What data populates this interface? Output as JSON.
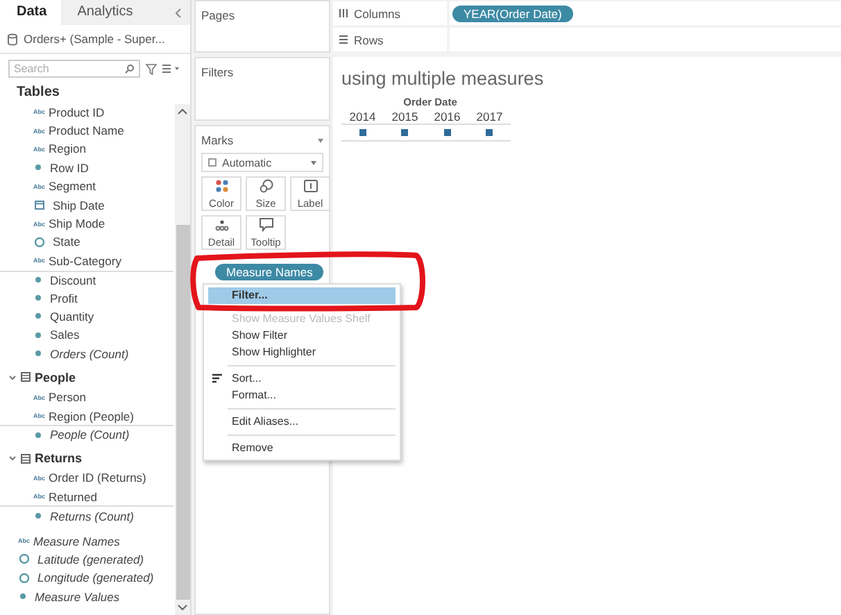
{
  "side_tabs": [
    {
      "label": "Data",
      "selected": true
    },
    {
      "label": "Analytics",
      "selected": false
    }
  ],
  "data_source": "Orders+ (Sample - Super...",
  "search": {
    "placeholder": "Search"
  },
  "tables": [
    {
      "name": "Tables",
      "collapsible": false,
      "expanded": true,
      "children": [
        {
          "name": "Product ID",
          "kind": "text",
          "type_label": "Abc",
          "italic": false
        },
        {
          "name": "Product Name",
          "kind": "text",
          "type_label": "Abc",
          "italic": false
        },
        {
          "name": "Region",
          "kind": "text",
          "type_label": "Abc",
          "italic": false
        },
        {
          "name": "Row ID",
          "kind": "number",
          "italic": false
        },
        {
          "name": "Segment",
          "kind": "text",
          "type_label": "Abc",
          "italic": false
        },
        {
          "name": "Ship Date",
          "kind": "date",
          "italic": false
        },
        {
          "name": "Ship Mode",
          "kind": "text",
          "type_label": "Abc",
          "italic": false
        },
        {
          "name": "State",
          "kind": "geo",
          "italic": false
        },
        {
          "name": "Sub-Category",
          "kind": "text",
          "type_label": "Abc",
          "italic": false
        },
        {
          "name": "Discount",
          "kind": "number",
          "italic": false,
          "divider_above": true
        },
        {
          "name": "Profit",
          "kind": "number",
          "italic": false
        },
        {
          "name": "Quantity",
          "kind": "number",
          "italic": false
        },
        {
          "name": "Sales",
          "kind": "number",
          "italic": false
        },
        {
          "name": "Orders (Count)",
          "kind": "number",
          "italic": true
        }
      ]
    },
    {
      "name": "People",
      "collapsible": true,
      "expanded": true,
      "children": [
        {
          "name": "Person",
          "kind": "text",
          "type_label": "Abc",
          "italic": false
        },
        {
          "name": "Region (People)",
          "kind": "text",
          "type_label": "Abc",
          "italic": false
        },
        {
          "name": "People (Count)",
          "kind": "number",
          "italic": true,
          "divider_above": true
        }
      ]
    },
    {
      "name": "Returns",
      "collapsible": true,
      "expanded": true,
      "children": [
        {
          "name": "Order ID (Returns)",
          "kind": "text",
          "type_label": "Abc",
          "italic": false
        },
        {
          "name": "Returned",
          "kind": "text",
          "type_label": "Abc",
          "italic": false
        },
        {
          "name": "Returns (Count)",
          "kind": "number",
          "italic": true,
          "divider_above": true
        }
      ]
    }
  ],
  "loose_fields": [
    {
      "name": "Measure Names",
      "kind": "text",
      "type_label": "Abc",
      "italic": true
    },
    {
      "name": "Latitude (generated)",
      "kind": "geo",
      "italic": true
    },
    {
      "name": "Longitude (generated)",
      "kind": "geo",
      "italic": true
    },
    {
      "name": "Measure Values",
      "kind": "number",
      "italic": true
    }
  ],
  "cards": [
    {
      "title": "Pages",
      "kind": "pages"
    },
    {
      "title": "Filters",
      "kind": "filters"
    }
  ],
  "marks": {
    "title": "Marks",
    "mark_type": "Automatic",
    "buttons": [
      {
        "label": "Color",
        "kind": "color"
      },
      {
        "label": "Size",
        "kind": "size"
      },
      {
        "label": "Label",
        "kind": "label"
      },
      {
        "label": "Detail",
        "kind": "detail"
      },
      {
        "label": "Tooltip",
        "kind": "tooltip"
      }
    ],
    "pill": {
      "label": "Measure Names",
      "kind": "color"
    }
  },
  "shelves": [
    {
      "label": "Columns",
      "kind": "columns",
      "pills": [
        "YEAR(Order Date)"
      ]
    },
    {
      "label": "Rows",
      "kind": "rows"
    }
  ],
  "view": {
    "title": "using multiple measures",
    "header": "Order Date",
    "columns": [
      "2014",
      "2015",
      "2016",
      "2017"
    ]
  },
  "context_menu": [
    {
      "kind": "item",
      "label": "Filter...",
      "selected": true,
      "disabled": false
    },
    {
      "kind": "item",
      "label": "Show Measure Values Shelf",
      "selected": false,
      "disabled": true
    },
    {
      "kind": "item",
      "label": "Show Filter",
      "selected": false,
      "disabled": false
    },
    {
      "kind": "item",
      "label": "Show Highlighter",
      "selected": false,
      "disabled": false
    },
    {
      "kind": "separator"
    },
    {
      "kind": "sort",
      "label": "Sort...",
      "selected": false,
      "disabled": false
    },
    {
      "kind": "item",
      "label": "Format...",
      "selected": false,
      "disabled": false
    },
    {
      "kind": "separator"
    },
    {
      "kind": "item",
      "label": "Edit Aliases...",
      "selected": false,
      "disabled": false
    },
    {
      "kind": "separator"
    },
    {
      "kind": "item",
      "label": "Remove",
      "selected": false,
      "disabled": false
    }
  ],
  "annotation": {
    "kind": "ring"
  }
}
